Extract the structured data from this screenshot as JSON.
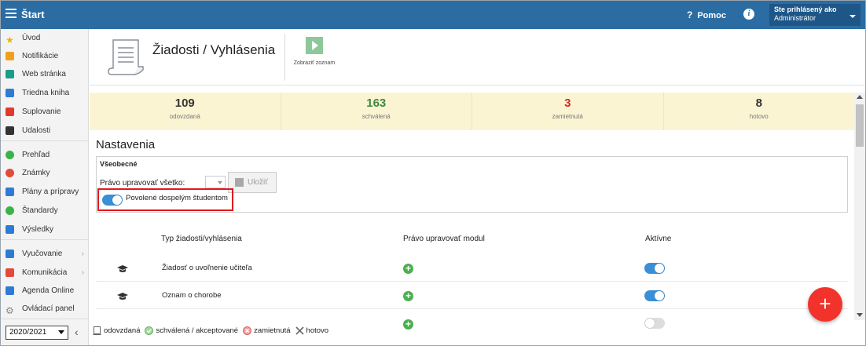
{
  "topbar": {
    "app_title": "Štart",
    "help_label": "Pomoc",
    "help_glyph": "?",
    "info_glyph": "i",
    "user_caption": "Ste prihlásený ako",
    "user_name": "Administrátor"
  },
  "sidebar": {
    "items": [
      {
        "label": "Úvod",
        "icon": "star-icon",
        "color": "#f0b400"
      },
      {
        "label": "Notifikácie",
        "icon": "envelope-icon",
        "color": "#f0a020"
      },
      {
        "label": "Web stránka",
        "icon": "home-icon",
        "color": "#1a9c8a"
      },
      {
        "label": "Triedna kniha",
        "icon": "book-icon",
        "color": "#2e7bd6"
      },
      {
        "label": "Suplovanie",
        "icon": "substitute-icon",
        "color": "#e2392e"
      },
      {
        "label": "Udalosti",
        "icon": "calendar-icon",
        "color": "#333333"
      },
      {
        "label": "Prehľad",
        "icon": "check-circle-icon",
        "color": "#3bb34a"
      },
      {
        "label": "Známky",
        "icon": "grades-icon",
        "color": "#e24b3b"
      },
      {
        "label": "Plány a prípravy",
        "icon": "briefcase-icon",
        "color": "#2e7bd6"
      },
      {
        "label": "Štandardy",
        "icon": "shield-icon",
        "color": "#3bb34a"
      },
      {
        "label": "Výsledky",
        "icon": "bar-chart-icon",
        "color": "#2e7bd6"
      },
      {
        "label": "Vyučovanie",
        "icon": "teaching-icon",
        "color": "#2e7bd6"
      },
      {
        "label": "Komunikácia",
        "icon": "communication-icon",
        "color": "#e24b3b"
      },
      {
        "label": "Agenda Online",
        "icon": "pen-icon",
        "color": "#2e7bd6"
      },
      {
        "label": "Ovládací panel",
        "icon": "gear-icon",
        "color": "#888888"
      }
    ],
    "chevron_glyph": "›",
    "school_year": "2020/2021",
    "collapse_glyph": "‹"
  },
  "header": {
    "page_title": "Žiadosti / Vyhlásenia",
    "show_list_label": "Zobraziť zoznam"
  },
  "stats": [
    {
      "value": "109",
      "caption": "odovzdaná",
      "color": "#333333"
    },
    {
      "value": "163",
      "caption": "schválená",
      "color": "#3c8a3c"
    },
    {
      "value": "3",
      "caption": "zamietnutá",
      "color": "#d22b1f"
    },
    {
      "value": "8",
      "caption": "hotovo",
      "color": "#333333"
    }
  ],
  "settings": {
    "title": "Nastavenia",
    "group_title": "Všeobecné",
    "edit_all_label": "Právo upravovať všetko:",
    "save_label": "Uložiť",
    "adult_students_label": "Povolené dospelým študentom",
    "adult_students_enabled": true
  },
  "table": {
    "headers": {
      "type": "Typ žiadosti/vyhlásenia",
      "edit_module": "Právo upravovať modul",
      "active": "Aktívne"
    },
    "rows": [
      {
        "name": "Žiadosť o uvoľnenie učiteľa",
        "active": true
      },
      {
        "name": "Oznam o chorobe",
        "active": true
      }
    ]
  },
  "fab_label": "+",
  "legend": [
    {
      "label": "odovzdaná",
      "icon": "submitted-icon"
    },
    {
      "label": "schválená / akceptované",
      "icon": "approved-icon"
    },
    {
      "label": "zamietnutá",
      "icon": "rejected-icon"
    },
    {
      "label": "hotovo",
      "icon": "done-icon"
    }
  ]
}
